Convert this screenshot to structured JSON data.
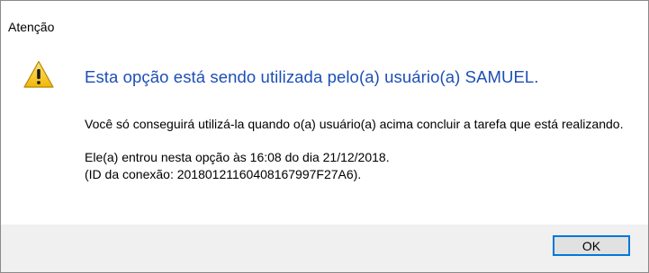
{
  "window": {
    "title": "Atenção"
  },
  "icon": {
    "name": "warning-icon",
    "fill": "#f5c61a",
    "stroke": "#a07a00"
  },
  "message": {
    "main_instruction": "Esta opção está sendo utilizada pelo(a) usuário(a) SAMUEL.",
    "paragraph1": "Você só conseguirá utilizá-la quando o(a) usuário(a) acima concluir a tarefa que está realizando.",
    "paragraph2_line1": "Ele(a) entrou nesta opção às 16:08 do dia 21/12/2018.",
    "paragraph2_line2": "(ID da conexão: 20180121160408167997F27A6)."
  },
  "buttons": {
    "ok_label": "OK"
  },
  "colors": {
    "accent": "#0078d7",
    "instruction_text": "#1c4fb5",
    "footer_bg": "#f0f0f0"
  }
}
